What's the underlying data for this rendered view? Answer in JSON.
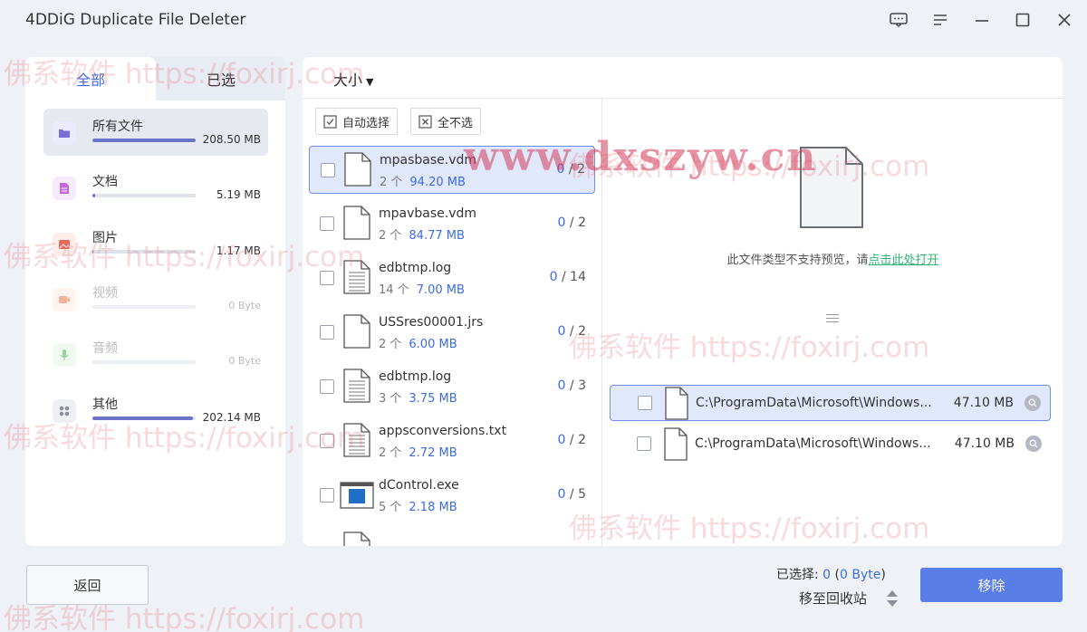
{
  "app": {
    "title": "4DDiG Duplicate File Deleter"
  },
  "window_controls": {
    "feedback_icon": "feedback-icon",
    "menu_icon": "menu-icon",
    "minimize_icon": "minimize-icon",
    "maximize_icon": "maximize-icon",
    "close_icon": "close-icon"
  },
  "sidebar": {
    "tabs": [
      {
        "label": "全部",
        "active": true
      },
      {
        "label": "已选",
        "active": false
      }
    ],
    "categories": [
      {
        "name": "所有文件",
        "size": "208.50 MB",
        "fill": 1.0,
        "icon": "folder-icon",
        "color": "#7a6fd8",
        "bg": "#ecebfb"
      },
      {
        "name": "文档",
        "size": "5.19 MB",
        "fill": 0.03,
        "icon": "document-icon",
        "color": "#c46ad8",
        "bg": "#f6ebfb"
      },
      {
        "name": "图片",
        "size": "1.17 MB",
        "fill": 0.01,
        "icon": "image-icon",
        "color": "#e66a5a",
        "bg": "#fdeeea"
      },
      {
        "name": "视频",
        "size": "0 Byte",
        "fill": 0,
        "icon": "video-icon",
        "color": "#f2b39a",
        "bg": "#fdf4ef"
      },
      {
        "name": "音频",
        "size": "0 Byte",
        "fill": 0,
        "icon": "audio-icon",
        "color": "#9ad49a",
        "bg": "#f0f9f0"
      },
      {
        "name": "其他",
        "size": "202.14 MB",
        "fill": 0.97,
        "icon": "other-icon",
        "color": "#8a8f99",
        "bg": "#eef0f3"
      }
    ]
  },
  "sort": {
    "label": "大小"
  },
  "toolbar": {
    "auto_select": "自动选择",
    "deselect_all": "全不选"
  },
  "files": [
    {
      "name": "mpasbase.vdm",
      "count": "2 个",
      "size": "94.20 MB",
      "selected": "0",
      "total": "2",
      "type": "blank",
      "active": true
    },
    {
      "name": "mpavbase.vdm",
      "count": "2 个",
      "size": "84.77 MB",
      "selected": "0",
      "total": "2",
      "type": "blank",
      "active": false
    },
    {
      "name": "edbtmp.log",
      "count": "14 个",
      "size": "7.00 MB",
      "selected": "0",
      "total": "14",
      "type": "text",
      "active": false
    },
    {
      "name": "USSres00001.jrs",
      "count": "2 个",
      "size": "6.00 MB",
      "selected": "0",
      "total": "2",
      "type": "blank",
      "active": false
    },
    {
      "name": "edbtmp.log",
      "count": "3 个",
      "size": "3.75 MB",
      "selected": "0",
      "total": "3",
      "type": "text",
      "active": false
    },
    {
      "name": "appsconversions.txt",
      "count": "2 个",
      "size": "2.72 MB",
      "selected": "0",
      "total": "2",
      "type": "text",
      "active": false
    },
    {
      "name": "dControl.exe",
      "count": "5 个",
      "size": "2.18 MB",
      "selected": "0",
      "total": "5",
      "type": "exe",
      "active": false
    }
  ],
  "preview": {
    "message": "此文件类型不支持预览，请",
    "link": "点击此处打开"
  },
  "paths": [
    {
      "path": "C:\\ProgramData\\Microsoft\\Windows...",
      "size": "47.10 MB",
      "active": true
    },
    {
      "path": "C:\\ProgramData\\Microsoft\\Windows...",
      "size": "47.10 MB",
      "active": false
    }
  ],
  "footer": {
    "back": "返回",
    "selected_label": "已选择:",
    "selected_count": "0",
    "selected_size": "0 Byte",
    "recycle": "移至回收站",
    "remove": "移除"
  },
  "watermarks": [
    "佛系软件 https://foxirj.com",
    "www.dxszyw.cn"
  ]
}
